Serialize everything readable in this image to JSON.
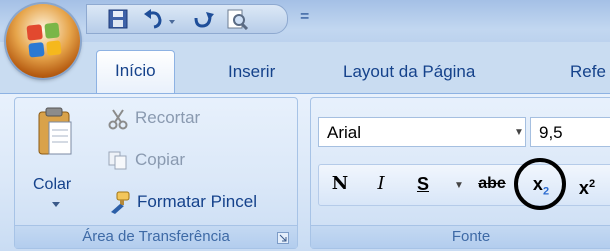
{
  "quick_access": {
    "icons": [
      "save-icon",
      "undo-icon",
      "redo-icon",
      "print-preview-icon",
      "customize-qat-icon"
    ],
    "customize_glyph": "="
  },
  "tabs": [
    {
      "label": "Início",
      "active": true
    },
    {
      "label": "Inserir",
      "active": false
    },
    {
      "label": "Layout da Página",
      "active": false
    },
    {
      "label": "Refe",
      "active": false
    }
  ],
  "clipboard": {
    "paste_label": "Colar",
    "cut_label": "Recortar",
    "copy_label": "Copiar",
    "format_painter_label": "Formatar Pincel",
    "group_label": "Área de Transferência"
  },
  "font": {
    "font_name": "Arial",
    "font_size": "9,5",
    "bold_label": "N",
    "italic_label": "I",
    "underline_label": "S",
    "strikethrough_label": "abe",
    "subscript_label": "x",
    "subscript_sub": "2",
    "superscript_label": "x",
    "superscript_sup": "2",
    "group_label": "Fonte"
  },
  "colors": {
    "ribbon_text": "#15428b",
    "highlight_circle": "#000000"
  }
}
